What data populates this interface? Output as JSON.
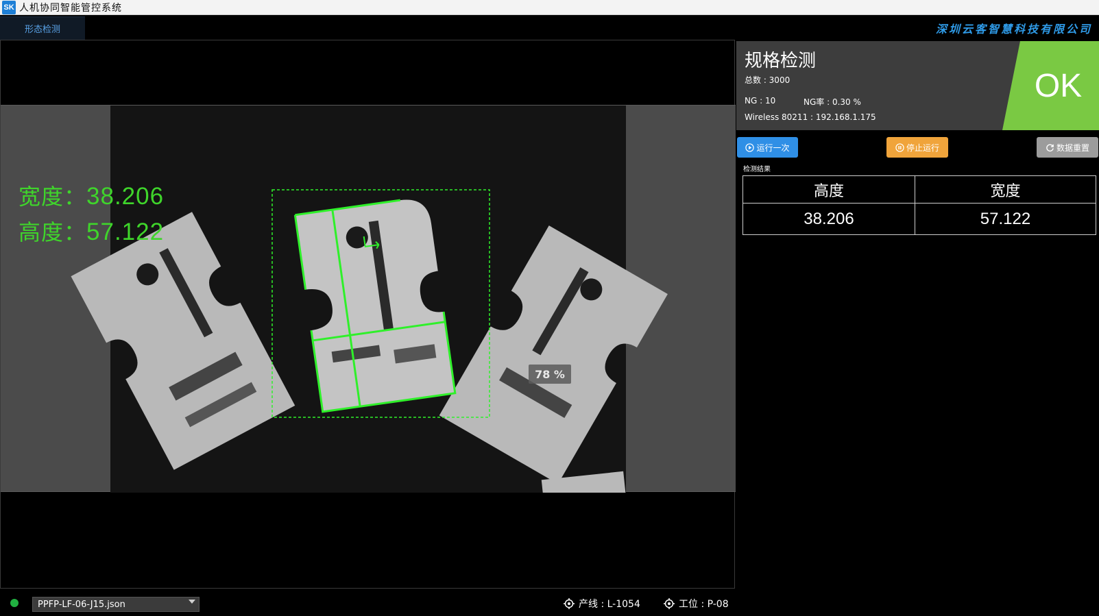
{
  "app": {
    "logo": "SK",
    "title": "人机协同智能管控系统"
  },
  "header": {
    "tab_active": "形态检测",
    "company": "深圳云客智慧科技有限公司"
  },
  "viewer": {
    "overlay": {
      "width_label": "宽度：",
      "width_value": "38.206",
      "height_label": "高度：",
      "height_value": "57.122"
    },
    "zoom": "78 %"
  },
  "status": {
    "connected_color": "#21b141",
    "file": "PPFP-LF-06-J15.json",
    "line_label": "产线 : L-1054",
    "station_label": "工位 : P-08"
  },
  "spec": {
    "title": "规格检测",
    "total": "总数 : 3000",
    "ng": "NG : 10",
    "ng_rate": "NG率 : 0.30 %",
    "wireless": "Wireless 80211 : 192.168.1.175",
    "result": "OK",
    "result_color": "#7ac943"
  },
  "buttons": {
    "run_once": "运行一次",
    "stop": "停止运行",
    "reset": "数据重置"
  },
  "results": {
    "label": "检测结果",
    "headers": [
      "高度",
      "宽度"
    ],
    "values": [
      "38.206",
      "57.122"
    ]
  }
}
